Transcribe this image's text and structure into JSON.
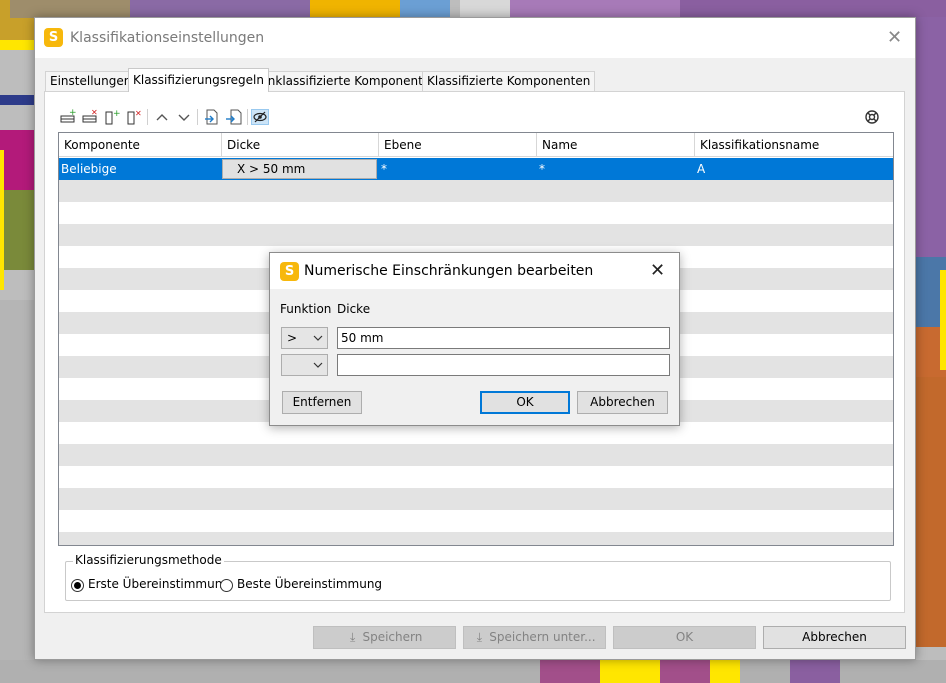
{
  "main_dialog": {
    "title": "Klassifikationseinstellungen",
    "app_icon_letter": "S",
    "tabs": [
      {
        "label": "Einstellungen",
        "active": false
      },
      {
        "label": "Klassifizierungsregeln",
        "active": true
      },
      {
        "label": "Unklassifizierte Komponenten",
        "active": false
      },
      {
        "label": "Klassifizierte Komponenten",
        "active": false
      }
    ],
    "toolbar_icons": [
      "add-row-icon",
      "delete-row-icon",
      "add-column-icon",
      "delete-column-icon",
      "move-up-icon",
      "move-down-icon",
      "export-icon",
      "import-icon",
      "visibility-icon",
      "help-icon"
    ],
    "grid": {
      "columns": [
        "Komponente",
        "Dicke",
        "Ebene",
        "Name",
        "Klassifikationsname"
      ],
      "rows": [
        {
          "komponente": "Beliebige",
          "dicke": "X > 50 mm",
          "ebene": "*",
          "name": "*",
          "klassifikationsname": "A"
        }
      ]
    },
    "classification_method": {
      "legend": "Klassifizierungsmethode",
      "options": [
        {
          "label": "Erste Übereinstimmung",
          "checked": true
        },
        {
          "label": "Beste Übereinstimmung",
          "checked": false
        }
      ]
    },
    "footer_buttons": {
      "save": "Speichern",
      "save_as": "Speichern unter...",
      "ok": "OK",
      "cancel": "Abbrechen"
    }
  },
  "modal": {
    "title": "Numerische Einschränkungen bearbeiten",
    "app_icon_letter": "S",
    "label_function": "Funktion",
    "label_thickness": "Dicke",
    "row1": {
      "function": ">",
      "value": "50 mm"
    },
    "row2": {
      "function": "",
      "value": ""
    },
    "buttons": {
      "remove": "Entfernen",
      "ok": "OK",
      "cancel": "Abbrechen"
    }
  },
  "colors": {
    "accent": "#0078d7",
    "app_icon": "#f7b80c",
    "selected_row": "#0078d7",
    "alt_row": "#e3e3e3"
  }
}
